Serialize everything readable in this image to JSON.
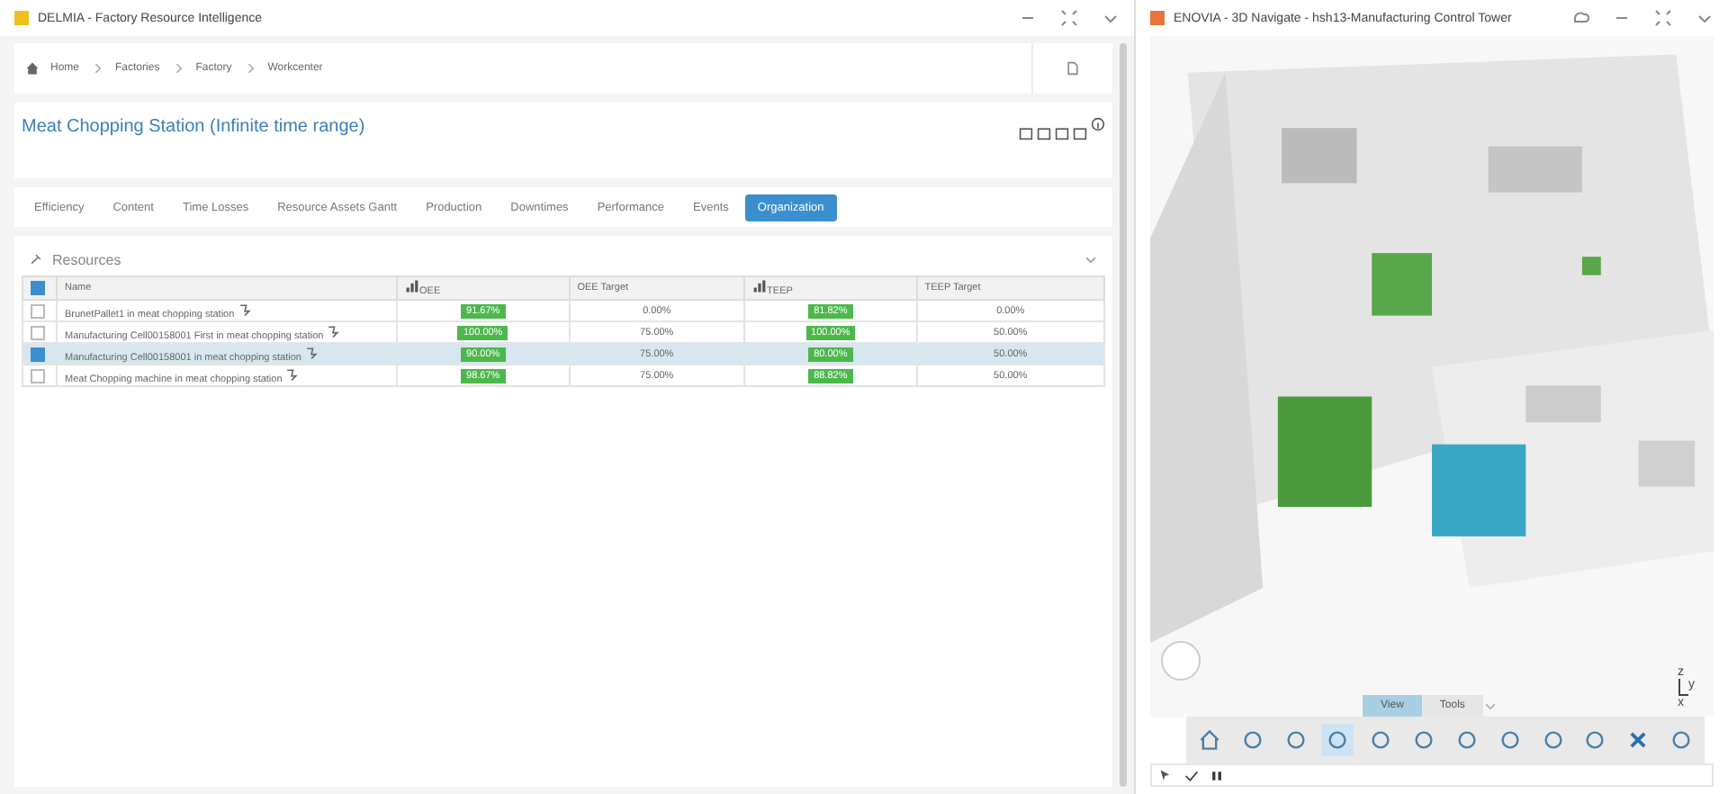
{
  "left_window": {
    "title": "DELMIA - Factory Resource Intelligence",
    "breadcrumb": [
      "Home",
      "Factories",
      "Factory",
      "Workcenter"
    ],
    "heading": "Meat Chopping Station (Infinite time range)",
    "tabs": [
      {
        "label": "Efficiency",
        "selected": false
      },
      {
        "label": "Content",
        "selected": false
      },
      {
        "label": "Time Losses",
        "selected": false
      },
      {
        "label": "Resource Assets Gantt",
        "selected": false
      },
      {
        "label": "Production",
        "selected": false
      },
      {
        "label": "Downtimes",
        "selected": false
      },
      {
        "label": "Performance",
        "selected": false
      },
      {
        "label": "Events",
        "selected": false
      },
      {
        "label": "Organization",
        "selected": true
      }
    ],
    "section": {
      "title": "Resources",
      "expanded": true
    },
    "table": {
      "all_checked": true,
      "columns": [
        {
          "label": "Name",
          "kind": "text"
        },
        {
          "label": "OEE",
          "kind": "badge"
        },
        {
          "label": "OEE Target",
          "kind": "plain"
        },
        {
          "label": "TEEP",
          "kind": "badge"
        },
        {
          "label": "TEEP Target",
          "kind": "plain"
        }
      ],
      "rows": [
        {
          "checked": false,
          "selected": false,
          "cells": [
            "BrunetPallet1 in meat chopping station",
            "91.67%",
            "0.00%",
            "81.82%",
            "0.00%"
          ]
        },
        {
          "checked": false,
          "selected": false,
          "cells": [
            "Manufacturing Cell00158001 First in meat chopping station",
            "100.00%",
            "75.00%",
            "100.00%",
            "50.00%"
          ]
        },
        {
          "checked": true,
          "selected": true,
          "cells": [
            "Manufacturing Cell00158001 in meat chopping station",
            "90.00%",
            "75.00%",
            "80.00%",
            "50.00%"
          ]
        },
        {
          "checked": false,
          "selected": false,
          "cells": [
            "Meat Chopping machine in meat chopping station",
            "98.67%",
            "75.00%",
            "88.82%",
            "50.00%"
          ]
        }
      ]
    }
  },
  "right_window": {
    "title": "ENOVIA - 3D Navigate - hsh13-Manufacturing Control Tower",
    "toolbar_tabs": [
      {
        "label": "View",
        "selected": true
      },
      {
        "label": "Tools",
        "selected": false
      }
    ],
    "axes": [
      "z",
      "y",
      "x"
    ]
  }
}
